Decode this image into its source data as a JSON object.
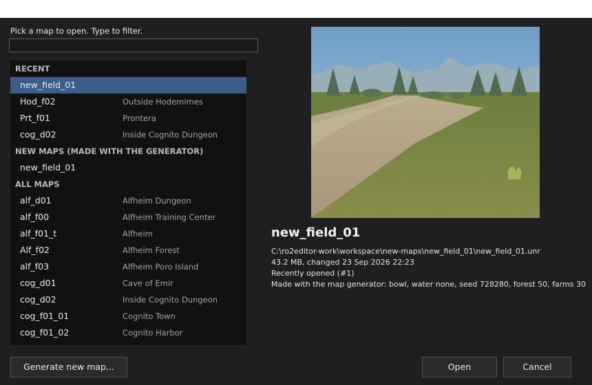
{
  "dialog": {
    "prompt": "Pick a map to open.  Type to filter.",
    "filter_value": ""
  },
  "list": {
    "recent_header": "RECENT",
    "recent": [
      {
        "name": "new_field_01",
        "desc": ""
      },
      {
        "name": "Hod_f02",
        "desc": "Outside Hodemimes"
      },
      {
        "name": "Prt_f01",
        "desc": "Prontera"
      },
      {
        "name": "cog_d02",
        "desc": "Inside Cognito Dungeon"
      }
    ],
    "new_header": "NEW MAPS (MADE WITH THE GENERATOR)",
    "new_maps": [
      {
        "name": "new_field_01",
        "desc": ""
      }
    ],
    "all_header": "ALL MAPS",
    "all_maps": [
      {
        "name": "alf_d01",
        "desc": "Alfheim Dungeon"
      },
      {
        "name": "alf_f00",
        "desc": "Alfheim Training Center"
      },
      {
        "name": "alf_f01_t",
        "desc": "Alfheim"
      },
      {
        "name": "Alf_f02",
        "desc": "Alfheim Forest"
      },
      {
        "name": "alf_f03",
        "desc": "Alfheim Poro Island"
      },
      {
        "name": "cog_d01",
        "desc": "Cave of Emir"
      },
      {
        "name": "cog_d02",
        "desc": "Inside Cognito Dungeon"
      },
      {
        "name": "cog_f01_01",
        "desc": "Cognito Town"
      },
      {
        "name": "cog_f01_02",
        "desc": "Cognito Harbor"
      }
    ]
  },
  "info": {
    "title": "new_field_01",
    "path": "C:\\ro2editor-work\\workspace\\new-maps\\new_field_01\\new_field_01.unr",
    "size_changed": "43.2 MB, changed 23 Sep 2026 22:23",
    "recent": "Recently opened (#1)",
    "generator": "Made with the map generator: bowl, water none, seed 728280, forest 50, farms 30"
  },
  "buttons": {
    "generate": "Generate new map...",
    "open": "Open",
    "cancel": "Cancel"
  },
  "colors": {
    "selection": "#3c5d8a",
    "background": "#1f1f21",
    "list_background": "#111112"
  }
}
